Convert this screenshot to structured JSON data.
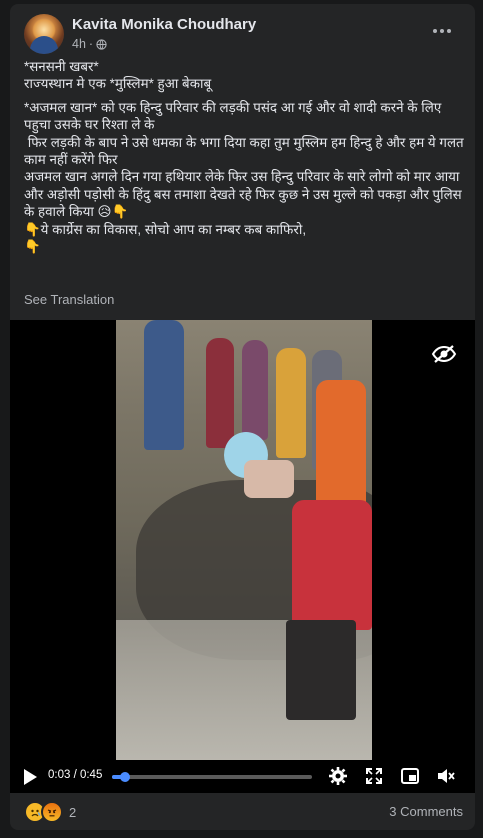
{
  "post": {
    "author": "Kavita Monika Choudhary",
    "time": "4h",
    "time_sep": "·",
    "visibility_icon": "globe-icon",
    "more_icon": "more-options-icon",
    "text_lines": [
      "*सनसनी खबर*",
      "राज्यस्थान मे एक *मुस्लिम* हुआ बेकाबू"
    ],
    "text_lines_2": [
      "*अजमल खान* को एक हिन्दु परिवार की लड़की पसंद आ गई और वो शादी करने के लिए पहुचा उसके घर रिश्ता ले के",
      " फिर लड़की के बाप ने उसे धमका के भगा दिया कहा तुम मुस्लिम हम हिन्दु हे और हम ये गलत काम नहीं करेंगे फिर",
      "अजमल खान अगले दिन गया हथियार लेके फिर उस हिन्दु परिवार के सारे लोगो को मार आया",
      "और अड़ोसी पड़ोसी के हिंदु  बस तमाशा देखते रहे फिर कुछ ने उस मुल्ले को पकड़ा और पुलिस के हवाले किया 😥👇",
      "👇ये कार्ग्रेस का विकास, सोचो आप का नम्बर कब काफिरो,",
      "👇"
    ],
    "see_translation": "See Translation"
  },
  "video": {
    "visibility_icon": "eye-off-icon",
    "time_display": "0:03 / 0:45",
    "progress_fraction": 0.067,
    "icons": [
      "play-icon",
      "settings-icon",
      "fullscreen-icon",
      "pip-icon",
      "mute-icon"
    ]
  },
  "footer": {
    "reactions": [
      "sad",
      "angry"
    ],
    "reaction_count": "2",
    "comments": "3 Comments"
  },
  "colors": {
    "background": "#18191a",
    "card": "#242526",
    "accent": "#4a8cff",
    "muted_text": "#b0b3b8"
  }
}
